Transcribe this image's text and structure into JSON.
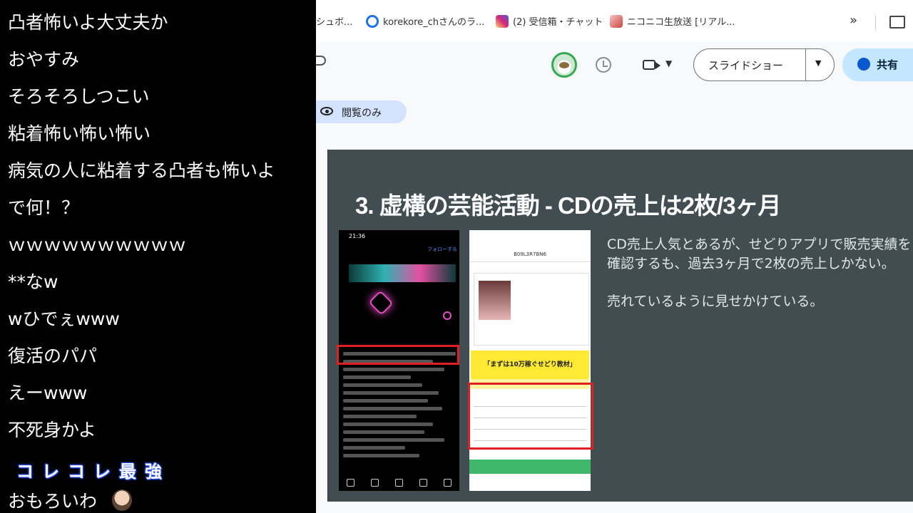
{
  "chat": {
    "comments": [
      "凸者怖いよ大丈夫か",
      "おやすみ",
      "そろそろしつこい",
      "粘着怖い怖い怖い",
      "病気の人に粘着する凸者も怖いよ",
      "で何！？",
      "ｗｗｗｗｗｗｗｗｗｗ",
      "**なw",
      "wひでぇwww",
      "復活のパパ",
      "えーwww",
      "不死身かよ"
    ],
    "special_comment": [
      "コ",
      "レ",
      "コ",
      "レ",
      "最",
      "強"
    ],
    "last_comment": "おもろいわ"
  },
  "bookmarks": {
    "items": [
      {
        "label": "シュボ...",
        "color": "#ffffff"
      },
      {
        "label": "korekore_chさんのラ...",
        "color": "#1a73e8"
      },
      {
        "label": "(2) 受信箱・チャット",
        "color": "#e1306c"
      },
      {
        "label": "ニコニコ生放送 [リアル...",
        "color": "#e88a8a"
      }
    ],
    "overflow": "»"
  },
  "toolbar": {
    "slideshow_label": "スライドショー",
    "share_label": "共有",
    "caret": "▼"
  },
  "viewonly": {
    "label": "閲覧のみ"
  },
  "slide": {
    "title": "3. 虚構の芸能活動 - CDの売上は2枚/3ヶ月",
    "body": [
      "CD売上人気とあるが、せどりアプリで販売実績を確認するも、過去3ヶ月で2枚の売上しかない。",
      "売れているように見せかけている。"
    ],
    "phone1": {
      "time": "21:36",
      "follow": "フォローする"
    },
    "phone2": {
      "code": "B09L3R7BN6",
      "banner": "「まずは10万稼ぐせどり教材」"
    }
  },
  "colors": {
    "chat_bg": "#000000",
    "slide_bg": "#424d52",
    "share_bg": "#c2e7ff",
    "highlight_red": "#e02020"
  }
}
